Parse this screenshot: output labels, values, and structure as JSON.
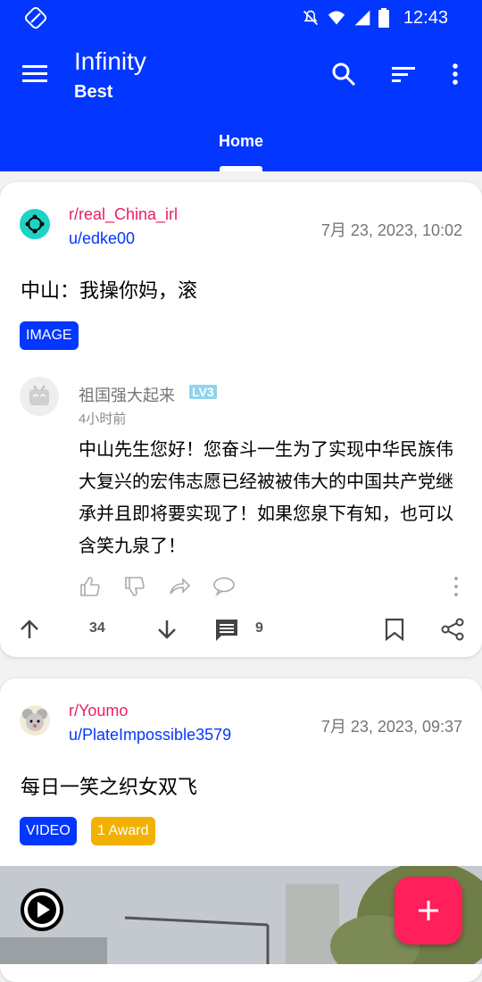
{
  "status": {
    "time": "12:43"
  },
  "header": {
    "title": "Infinity",
    "subtitle": "Best",
    "tab": "Home"
  },
  "colors": {
    "primary": "#0336ff",
    "subreddit": "#e91e63",
    "fab": "#ff1f5a",
    "award": "#f2b100"
  },
  "posts": [
    {
      "subreddit": "r/real_China_irl",
      "user": "u/edke00",
      "date": "7月 23, 2023, 10:02",
      "title": "中山：我操你妈，滚",
      "badges": [
        "IMAGE"
      ],
      "quote": {
        "name": "祖国强大起来",
        "level": "LV3",
        "time": "4小时前",
        "text": "中山先生您好！您奋斗一生为了实现中华民族伟大复兴的宏伟志愿已经被被伟大的中国共产党继承并且即将要实现了！如果您泉下有知，也可以含笑九泉了！"
      },
      "score": "34",
      "comments": "9"
    },
    {
      "subreddit": "r/Youmo",
      "user": "u/PlateImpossible3579",
      "date": "7月 23, 2023, 09:37",
      "title": "每日一笑之织女双飞",
      "badges": [
        "VIDEO",
        "1 Award"
      ]
    }
  ],
  "icons": [
    "vpn-icon",
    "mute-icon",
    "wifi-icon",
    "signal-icon",
    "battery-icon",
    "menu-icon",
    "search-icon",
    "sort-icon",
    "more-vert-icon",
    "upvote-icon",
    "downvote-icon",
    "comment-icon",
    "bookmark-icon",
    "share-icon",
    "play-icon",
    "add-icon"
  ]
}
